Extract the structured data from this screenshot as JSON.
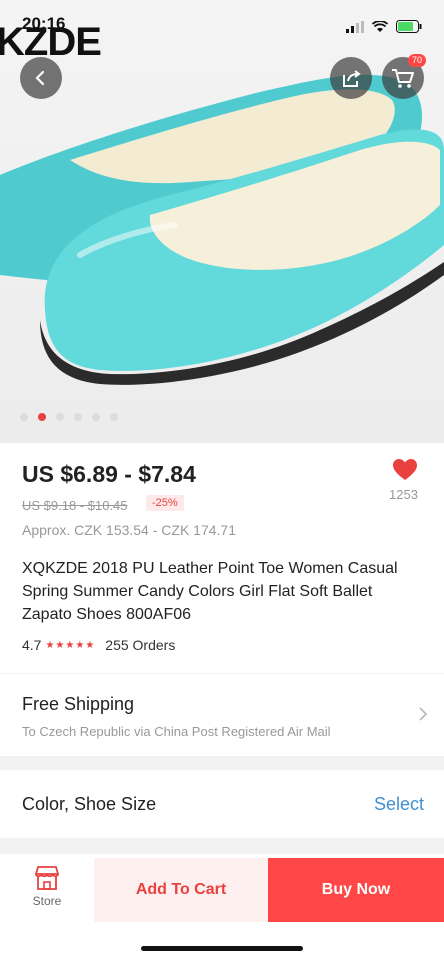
{
  "status": {
    "time": "20:16",
    "brand_overlay": "KZDE"
  },
  "header": {
    "cart_count": "70"
  },
  "gallery": {
    "image_count": 6,
    "active_index": 1
  },
  "product": {
    "price_range": "US $6.89 - $7.84",
    "original_price": "US $9.18 - $10.45",
    "discount": "-25%",
    "approx_price": "Approx. CZK 153.54 - CZK 174.71",
    "wishlist_count": "1253",
    "title": "XQKZDE 2018 PU Leather Point Toe Women Casual Spring Summer Candy Colors Girl Flat Soft Ballet Zapato Shoes 800AF06",
    "rating": "4.7",
    "stars": "★★★★★",
    "orders": "255 Orders"
  },
  "shipping": {
    "heading": "Free Shipping",
    "detail": "To Czech Republic via China Post Registered Air Mail"
  },
  "sku": {
    "label": "Color, Shoe Size",
    "action": "Select"
  },
  "bottom_bar": {
    "store_label": "Store",
    "add_to_cart": "Add To Cart",
    "buy_now": "Buy Now"
  },
  "colors": {
    "accent": "#ff4747",
    "link": "#3f8fd2",
    "shoe": "#5fd6d8"
  }
}
